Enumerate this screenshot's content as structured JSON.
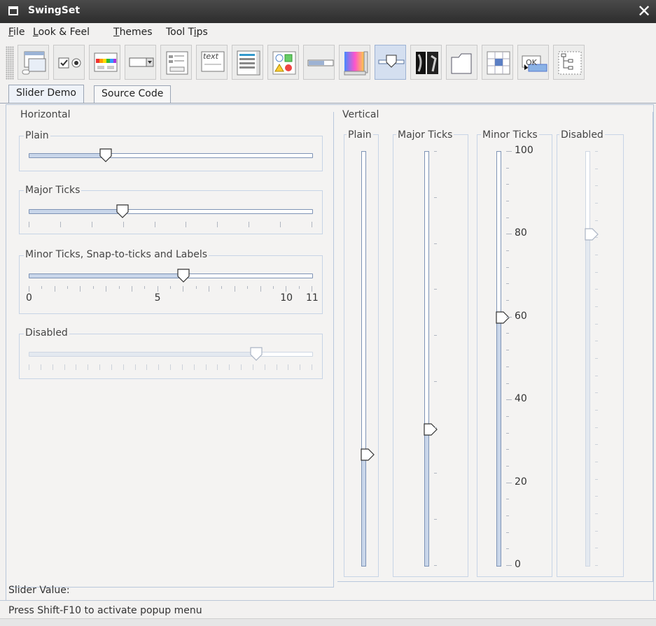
{
  "window": {
    "title": "SwingSet",
    "close_glyph": "✕"
  },
  "menubar": {
    "items": [
      {
        "first": "F",
        "rest": "ile"
      },
      {
        "first": "L",
        "rest": "ook & Feel"
      },
      {
        "first": "T",
        "rest": "hemes"
      },
      {
        "pre": "Tool T",
        "first": "i",
        "rest": "ps"
      }
    ]
  },
  "toolbar": {
    "buttons": [
      {
        "name": "internal-frame-demo-icon"
      },
      {
        "name": "button-demo-icon"
      },
      {
        "name": "color-chooser-demo-icon"
      },
      {
        "name": "combobox-demo-icon"
      },
      {
        "name": "file-chooser-demo-icon"
      },
      {
        "name": "editor-pane-demo-icon",
        "text": "text"
      },
      {
        "name": "list-demo-icon"
      },
      {
        "name": "option-pane-demo-icon"
      },
      {
        "name": "progress-bar-demo-icon"
      },
      {
        "name": "scroll-pane-demo-icon"
      },
      {
        "name": "slider-demo-icon",
        "selected": true
      },
      {
        "name": "split-pane-demo-icon"
      },
      {
        "name": "tabbed-pane-demo-icon"
      },
      {
        "name": "table-demo-icon"
      },
      {
        "name": "tooltip-demo-icon",
        "text": "OK"
      },
      {
        "name": "tree-demo-icon"
      }
    ]
  },
  "tabs": [
    {
      "label": "Slider Demo",
      "active": true
    },
    {
      "label": "Source Code",
      "active": false
    }
  ],
  "horizontal": {
    "title": "Horizontal",
    "plain": {
      "title": "Plain",
      "value": 0.27
    },
    "major": {
      "title": "Major Ticks",
      "value": 0.33
    },
    "minor": {
      "title": "Minor Ticks, Snap-to-ticks and Labels",
      "value": 6,
      "max": 11,
      "labels": [
        "0",
        "5",
        "10",
        "11"
      ]
    },
    "disabled": {
      "title": "Disabled",
      "value": 0.8
    }
  },
  "vertical": {
    "title": "Vertical",
    "plain": {
      "title": "Plain",
      "value": 0.27
    },
    "major": {
      "title": "Major Ticks",
      "value": 0.33
    },
    "minor": {
      "title": "Minor Ticks",
      "value": 60,
      "labels": [
        "100",
        "80",
        "60",
        "40",
        "20",
        "0"
      ]
    },
    "disabled": {
      "title": "Disabled",
      "value": 80
    }
  },
  "slider_value_label": "Slider Value:",
  "status": "Press Shift-F10 to activate popup menu"
}
